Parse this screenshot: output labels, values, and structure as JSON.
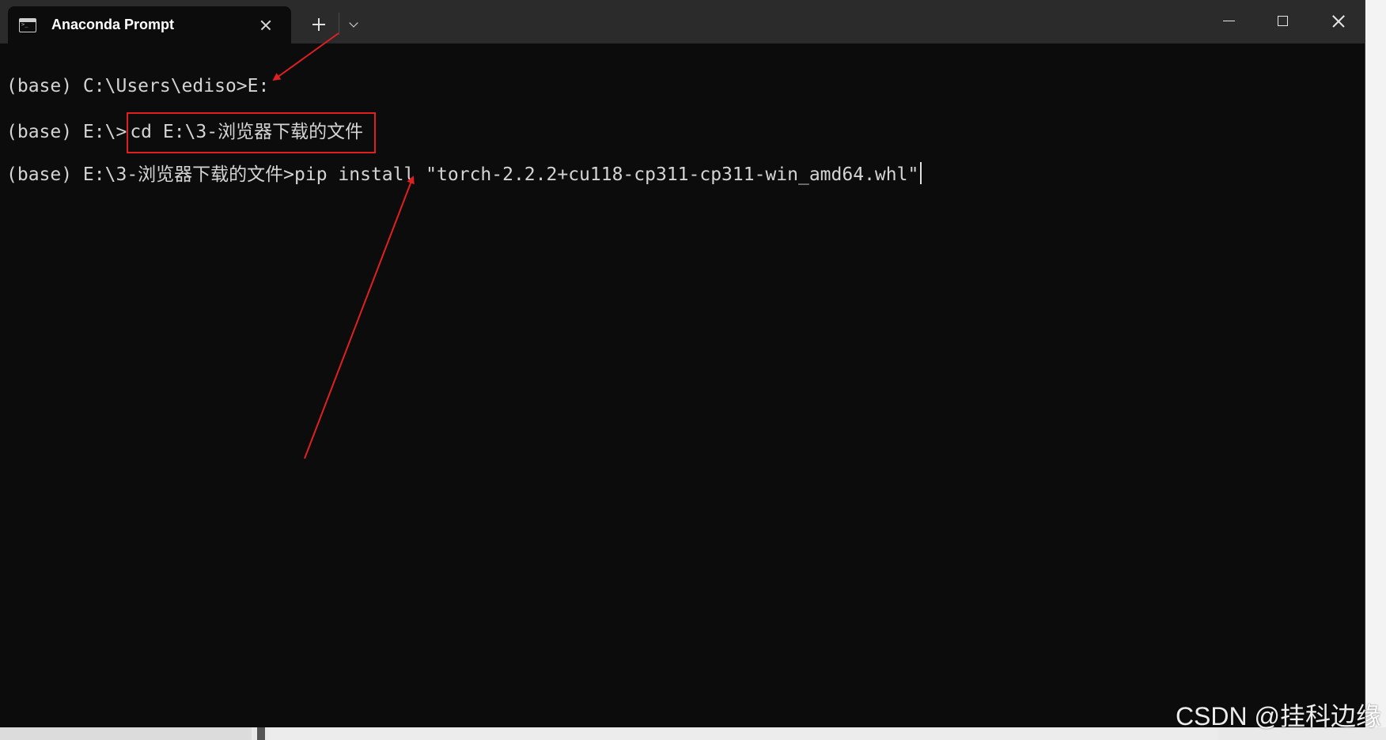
{
  "titlebar": {
    "tab_title": "Anaconda Prompt",
    "tab_icon": "terminal-icon",
    "new_tab_icon": "plus-icon",
    "dropdown_icon": "chevron-down-icon",
    "minimize_icon": "minimize-icon",
    "maximize_icon": "maximize-icon",
    "close_icon": "close-icon"
  },
  "terminal": {
    "lines": [
      {
        "prompt": "(base) C:\\Users\\ediso>",
        "command": "E:"
      },
      {
        "prompt": "(base) E:\\>",
        "command": "cd E:\\3-浏览器下载的文件"
      },
      {
        "prompt": "(base) E:\\3-浏览器下载的文件>",
        "command": "pip install \"torch-2.2.2+cu118-cp311-cp311-win_amd64.whl\""
      }
    ]
  },
  "colors": {
    "terminal_bg": "#0c0c0c",
    "titlebar_bg": "#2b2b2b",
    "text": "#d4d4d4",
    "annotation": "#e02020"
  },
  "watermark": "CSDN @挂科边缘"
}
